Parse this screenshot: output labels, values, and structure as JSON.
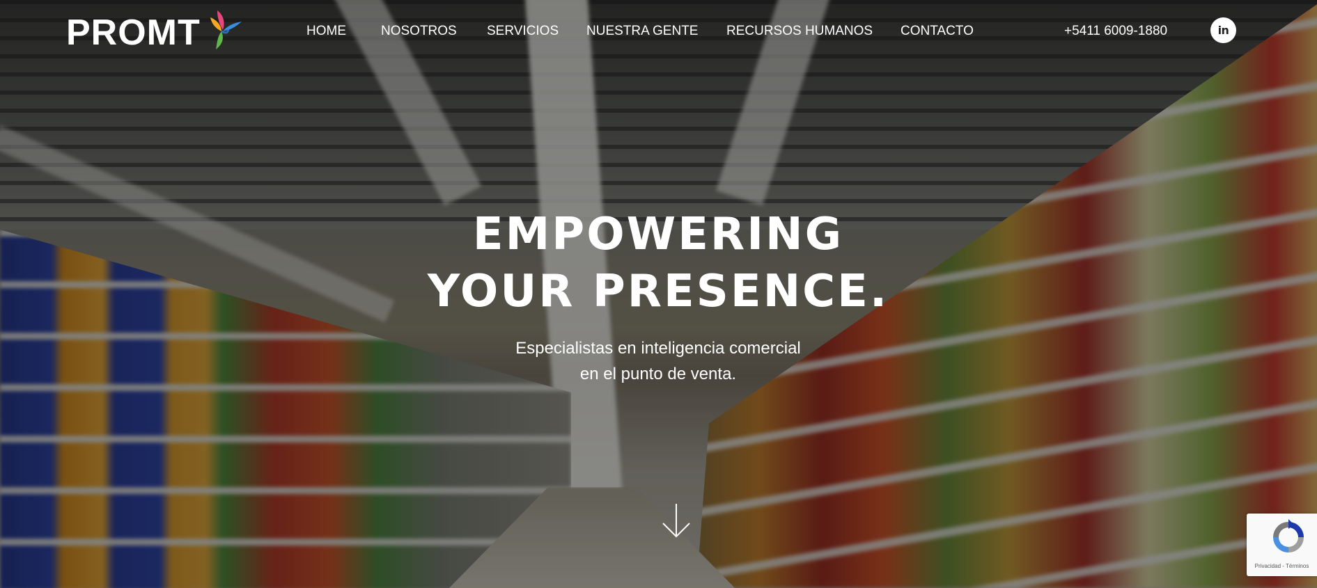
{
  "brand": {
    "name": "PROMT",
    "bird_colors": [
      "#e8467c",
      "#f5a623",
      "#3b8de0",
      "#5fb84a"
    ]
  },
  "nav": {
    "items": [
      {
        "label": "HOME"
      },
      {
        "label": "NOSOTROS"
      },
      {
        "label": "SERVICIOS"
      },
      {
        "label": "NUESTRA GENTE"
      },
      {
        "label": "RECURSOS HUMANOS"
      },
      {
        "label": "CONTACTO"
      }
    ]
  },
  "contact": {
    "phone": "+5411 6009-1880",
    "linkedin_label": "in"
  },
  "hero": {
    "headline_line1": "EMPOWERING",
    "headline_line2": "YOUR PRESENCE.",
    "sub_line1": "Especialistas en inteligencia comercial",
    "sub_line2": "en el punto de venta.",
    "scroll_icon": "arrow-down-icon"
  },
  "recaptcha": {
    "links": "Privacidad - Términos"
  }
}
